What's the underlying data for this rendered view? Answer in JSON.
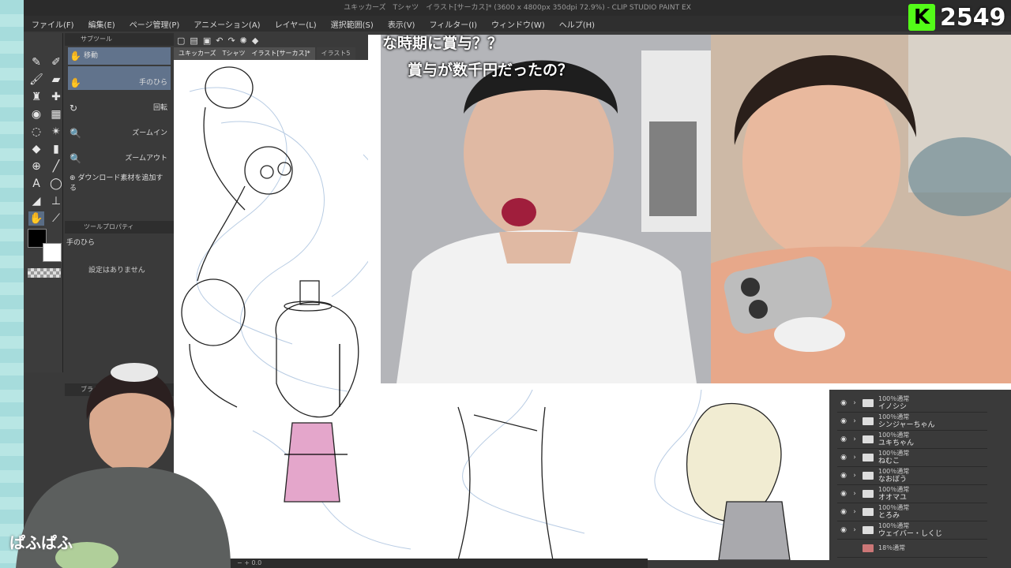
{
  "window": {
    "title": "ユキッカーズ　Tシャツ　イラスト[サーカス]* (3600 x 4800px 350dpi 72.9%)  - CLIP STUDIO PAINT EX"
  },
  "menu": [
    "ファイル(F)",
    "編集(E)",
    "ページ管理(P)",
    "アニメーション(A)",
    "レイヤー(L)",
    "選択範囲(S)",
    "表示(V)",
    "フィルター(I)",
    "ウィンドウ(W)",
    "ヘルプ(H)"
  ],
  "canvas_tabs": [
    "ユキッカーズ　Tシャツ　イラスト[サーカス]*",
    "イラスト5"
  ],
  "sub_tool": {
    "header": "サブツール",
    "items": [
      "移動",
      "手のひら",
      "回転",
      "ズームイン",
      "ズームアウト"
    ],
    "add_material": "ダウンロード素材を追加する"
  },
  "tool_property": {
    "header": "ツールプロパティ",
    "tool_name": "手のひら",
    "empty_text": "設定はありません"
  },
  "brush_panel": {
    "header": "ブラシサ"
  },
  "layers": [
    {
      "opacity": "100％通常",
      "name": "イノシシ"
    },
    {
      "opacity": "100％通常",
      "name": "シンジャーちゃん"
    },
    {
      "opacity": "100％通常",
      "name": "ユキちゃん"
    },
    {
      "opacity": "100％通常",
      "name": "ねむこ"
    },
    {
      "opacity": "100％通常",
      "name": "なおぼう"
    },
    {
      "opacity": "100％通常",
      "name": "オオマユ"
    },
    {
      "opacity": "100％通常",
      "name": "とろみ"
    },
    {
      "opacity": "100％通常",
      "name": "ウェイバー・しくじ"
    },
    {
      "opacity": "18％通常",
      "name": ""
    }
  ],
  "status": {
    "zoom": "0.0"
  },
  "overlay": {
    "caption_line1": "な時期に賞与？？",
    "caption_line2": "賞与が数千円だったの？"
  },
  "viewer_badge": {
    "logo": "K",
    "count": "2549"
  },
  "webcam": {
    "name": "ぱふぱふ"
  },
  "colors": {
    "kick_green": "#53fc18",
    "panel_dark": "#3a3a3a",
    "selection": "#61738c"
  }
}
